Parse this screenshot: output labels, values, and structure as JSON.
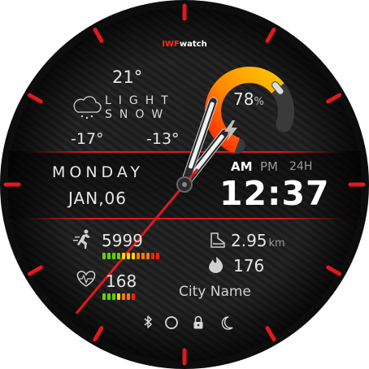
{
  "brand": {
    "part1": "IWF",
    "part2": "watch"
  },
  "weather": {
    "temp": "21°",
    "condition_line1": "LIGHT",
    "condition_line2": "SNOW",
    "low": "-17°",
    "high": "-13°",
    "icon": "cloud-snow-icon"
  },
  "battery": {
    "percent_text": "78",
    "unit": "%",
    "level": 0.78,
    "icon": "lightning-icon"
  },
  "date": {
    "weekday": "MONDAY",
    "date": "JAN,06"
  },
  "time": {
    "am": "AM",
    "pm": "PM",
    "h24": "24H",
    "clock": "12:37",
    "active": "AM"
  },
  "steps": {
    "value": "5999",
    "icon": "running-icon",
    "bar_levels": 12,
    "bar_lit": 12
  },
  "heart": {
    "value": "168",
    "icon": "heart-icon",
    "bar_levels": 7,
    "bar_lit": 7
  },
  "distance": {
    "value": "2.95",
    "unit": "km",
    "icon": "shoe-icon"
  },
  "calories": {
    "value": "176",
    "icon": "flame-icon"
  },
  "city": {
    "name": "City Name"
  },
  "status_icons": [
    "bluetooth-icon",
    "ring-icon",
    "lock-icon",
    "moon-icon"
  ],
  "colors": {
    "accent": "#e0191e",
    "gauge_start": "#ffc400",
    "gauge_end": "#ff2200",
    "bar_green": "#5fd400",
    "bar_yellow": "#ffd400",
    "bar_orange": "#ff7a00",
    "bar_red": "#ff1e00"
  }
}
